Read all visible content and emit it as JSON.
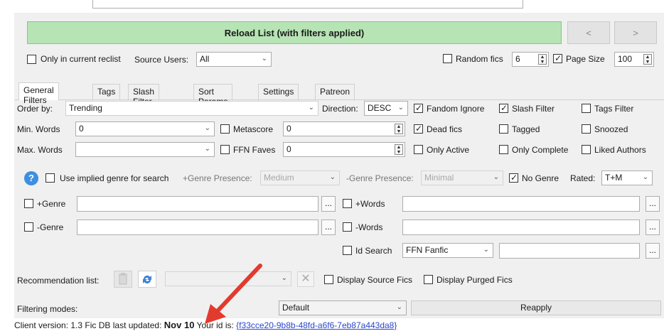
{
  "header": {
    "reload_label": "Reload List (with filters applied)",
    "prev_label": "<",
    "next_label": ">",
    "only_in_reclist_label": "Only in current reclist",
    "source_users_label": "Source Users:",
    "source_users_value": "All",
    "random_fics_label": "Random fics",
    "random_fics_value": "6",
    "page_size_label": "Page Size",
    "page_size_value": "100"
  },
  "tabs": [
    {
      "label": "General Filters"
    },
    {
      "label": "Tags"
    },
    {
      "label": "Slash Filter"
    },
    {
      "label": "Sort Params"
    },
    {
      "label": "Settings"
    },
    {
      "label": "Patreon"
    }
  ],
  "filters": {
    "order_by_label": "Order by:",
    "order_by_value": "Trending",
    "direction_label": "Direction:",
    "direction_value": "DESC",
    "fandom_ignore": "Fandom Ignore",
    "slash_filter": "Slash Filter",
    "tags_filter": "Tags Filter",
    "min_words_label": "Min. Words",
    "min_words_value": "0",
    "metascore_label": "Metascore",
    "metascore_value": "0",
    "dead_fics": "Dead fics",
    "tagged": "Tagged",
    "snoozed": "Snoozed",
    "max_words_label": "Max. Words",
    "max_words_value": "",
    "ffn_faves_label": "FFN Faves",
    "ffn_faves_value": "0",
    "only_active": "Only Active",
    "only_complete": "Only Complete",
    "liked_authors": "Liked Authors",
    "help_glyph": "?",
    "use_implied_genre": "Use implied genre for search",
    "genre_presence_plus_label": "+Genre Presence:",
    "genre_presence_plus_value": "Medium",
    "genre_presence_minus_label": "-Genre Presence:",
    "genre_presence_minus_value": "Minimal",
    "no_genre": "No Genre",
    "rated_label": "Rated:",
    "rated_value": "T+M",
    "plus_genre": "+Genre",
    "minus_genre": "-Genre",
    "plus_words": "+Words",
    "minus_words": "-Words",
    "id_search": "Id Search",
    "id_search_type": "FFN Fanfic",
    "ellipsis": "...",
    "rec_list_label": "Recommendation list:",
    "display_source_fics": "Display Source Fics",
    "display_purged_fics": "Display Purged Fics",
    "filtering_modes_label": "Filtering modes:",
    "filtering_modes_value": "Default",
    "reapply_label": "Reapply"
  },
  "status": {
    "client_version": "Client version: 1.3",
    "fic_db_label": "Fic DB last updated:",
    "fic_db_date": "Nov 10",
    "your_id_label": "Your id is:",
    "your_id_value": "{f33cce20-9b8b-48fd-a6f6-7eb87a443da8}"
  },
  "colors": {
    "reload_bg": "#b7e4b5",
    "annotation_arrow": "#e23b2e",
    "link": "#2b46c9"
  }
}
